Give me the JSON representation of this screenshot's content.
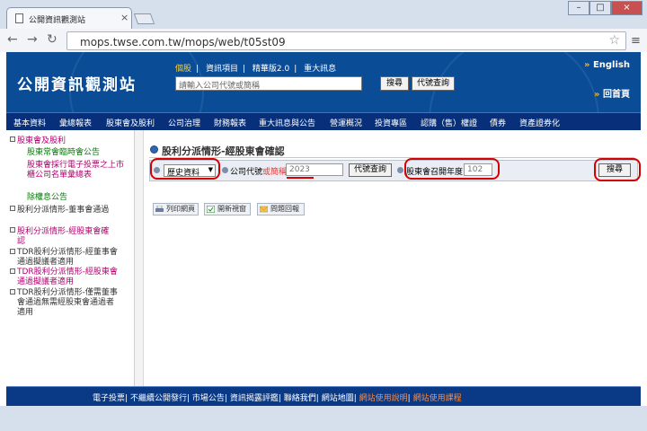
{
  "browser": {
    "tab_title": "公開資訊觀測站",
    "url": "mops.twse.com.tw/mops/web/t05st09"
  },
  "header": {
    "logo": "公開資訊觀測站",
    "top_links": [
      "個股",
      "資訊項目",
      "精華版2.0",
      "重大訊息"
    ],
    "separator": "|",
    "search_placeholder": "請輸入公司代號或簡稱",
    "search_button": "搜尋",
    "code_lookup_button": "代號查詢",
    "english_link": "English",
    "home_link": "回首頁"
  },
  "navbar": {
    "items": [
      "基本資料",
      "彙總報表",
      "股東會及股利",
      "公司治理",
      "財務報表",
      "重大訊息與公告",
      "營運概況",
      "投資專區",
      "認購（售）權證",
      "債券",
      "資產證券化"
    ]
  },
  "sidebar": {
    "items": [
      {
        "label": "股東會及股利",
        "color": "#b0006e"
      },
      {
        "label": "股東常會臨時會公告",
        "color": "#008000"
      },
      {
        "label": "股東會採行電子投票之上市櫃公司名單彙總表",
        "color": "#b0006e"
      },
      {
        "label": "除權息公告",
        "color": "#008000"
      },
      {
        "label": "股利分派情形-董事會通過",
        "color": "#333333"
      },
      {
        "label": "股利分派情形-經股東會確認",
        "color": "#b0006e"
      },
      {
        "label": "TDR股利分派情形-經董事會通過擬議者適用",
        "color": "#333333"
      },
      {
        "label": "TDR股利分派情形-經股東會通過擬議者適用",
        "color": "#b0006e"
      },
      {
        "label": "TDR股利分派情形-僅需董事會通過無需經股東會通過者適用",
        "color": "#333333"
      }
    ]
  },
  "main": {
    "title": "股利分派情形-經股東會確認",
    "query_type": "歷史資料",
    "company_label": "公司代號",
    "company_label_req": "或簡稱",
    "company_value": "2023",
    "code_lookup_button": "代號查詢",
    "meeting_year_label": "股東會召開年度",
    "meeting_year_value": "102",
    "search_button": "搜尋",
    "actions": [
      "列印網頁",
      "開新視窗",
      "問題回報"
    ]
  },
  "footer": {
    "links": [
      "電子投票",
      "不繼續公開發行",
      "市場公告",
      "資訊揭露評鑑",
      "聯絡我們",
      "網站地圖"
    ],
    "orange_links": [
      "網站使用說明",
      "網站使用課程"
    ],
    "separator": "|"
  },
  "colors": {
    "header_blue": "#0a4d96",
    "nav_blue": "#08307a",
    "highlight_red": "#d50000"
  }
}
